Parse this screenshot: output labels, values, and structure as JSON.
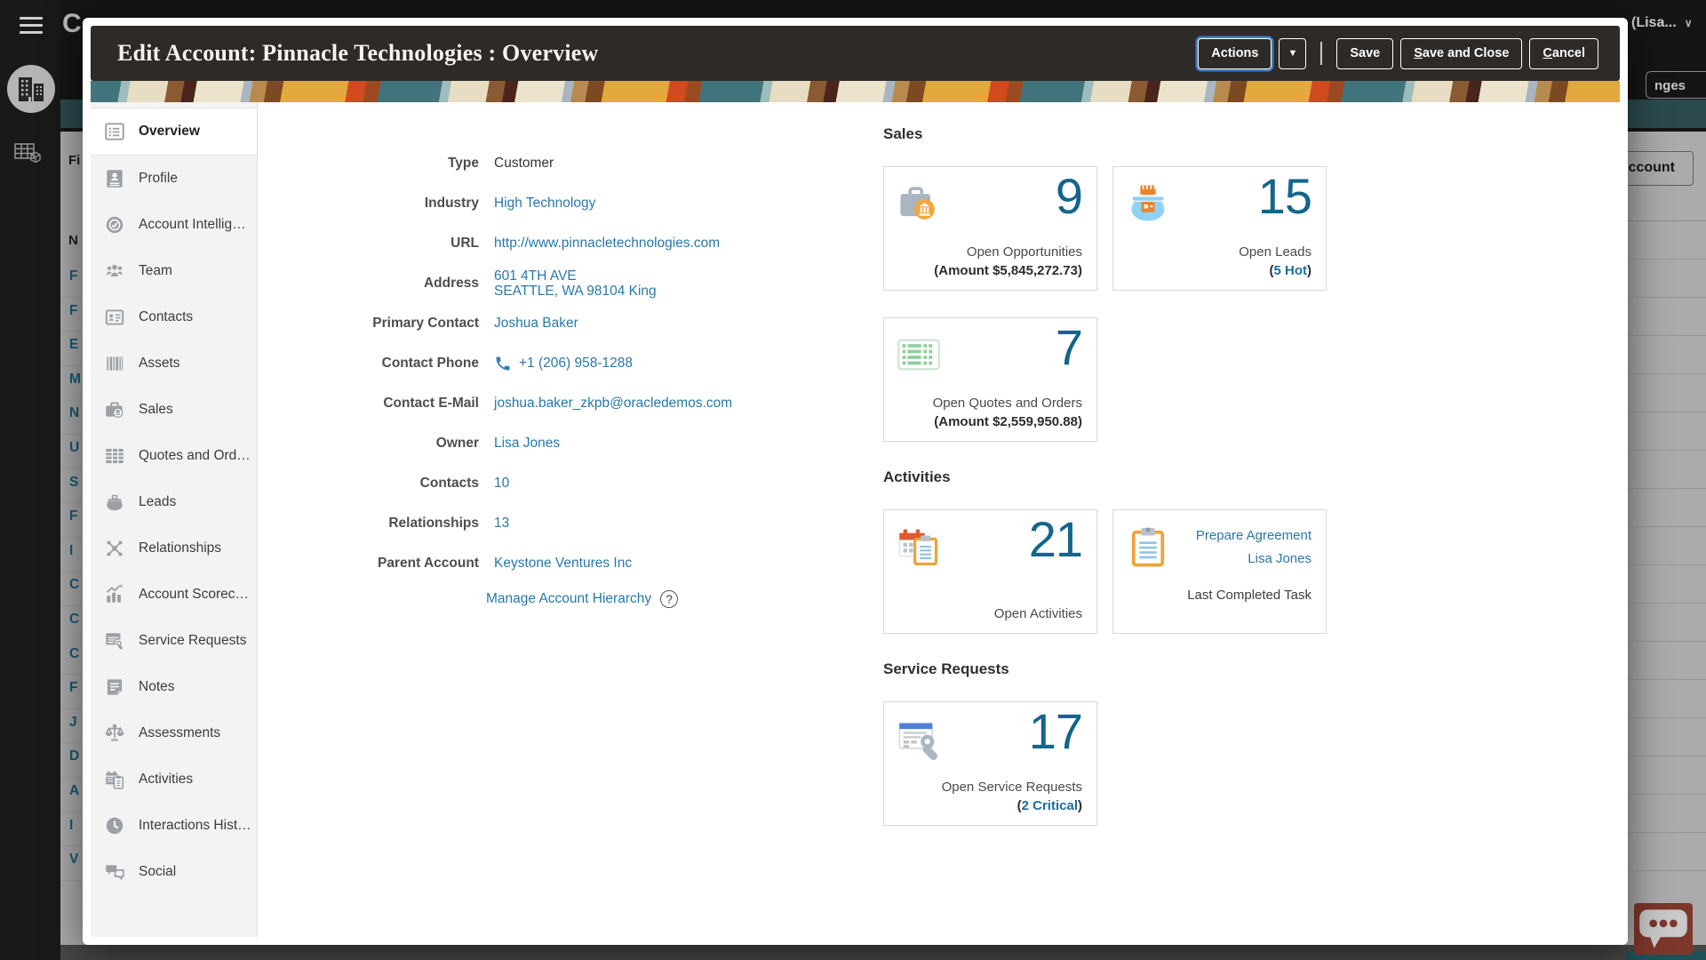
{
  "colors": {
    "accent_link": "#2878a8",
    "metric_number": "#13658b",
    "modal_header_bg": "#2e2a27",
    "sidebar_bg": "#f3f3f3",
    "card_border": "#d9d9d9",
    "bg_rail": "#191919",
    "bg_page": "#ababab",
    "bg_topbar": "#161513",
    "chat_orange": "#7d372b",
    "focus_ring": "#3d7fc2"
  },
  "background": {
    "user_menu_label": "(Lisa...",
    "user_menu_chevron": "∨",
    "changes_button_label": "nges",
    "account_button_label": "Account",
    "page_text_fragment": "Fi",
    "table_header_letter": "N",
    "row_letters": [
      "F",
      "F",
      "E",
      "M",
      "N",
      "U",
      "S",
      "F",
      "I",
      "C",
      "C",
      "C",
      "F",
      "J",
      "D",
      "A",
      "I",
      "V"
    ]
  },
  "modal": {
    "title": "Edit Account: Pinnacle Technologies : Overview",
    "toolbar": {
      "actions_label": "Actions",
      "actions_menu_icon": "▼",
      "save_label": "Save",
      "save_and_close_label": "Save and Close",
      "cancel_label": "Cancel"
    },
    "sidebar": {
      "items": [
        {
          "label": "Overview",
          "icon": "overview-icon",
          "selected": true
        },
        {
          "label": "Profile",
          "icon": "profile-icon"
        },
        {
          "label": "Account Intellig…",
          "icon": "account-intelligence-icon"
        },
        {
          "label": "Team",
          "icon": "team-icon"
        },
        {
          "label": "Contacts",
          "icon": "contacts-icon"
        },
        {
          "label": "Assets",
          "icon": "assets-icon"
        },
        {
          "label": "Sales",
          "icon": "sales-icon"
        },
        {
          "label": "Quotes and Ord…",
          "icon": "quotes-icon"
        },
        {
          "label": "Leads",
          "icon": "leads-icon"
        },
        {
          "label": "Relationships",
          "icon": "relationships-icon"
        },
        {
          "label": "Account Scorec…",
          "icon": "scorecard-icon"
        },
        {
          "label": "Service Requests",
          "icon": "service-requests-icon"
        },
        {
          "label": "Notes",
          "icon": "notes-icon"
        },
        {
          "label": "Assessments",
          "icon": "assessments-icon"
        },
        {
          "label": "Activities",
          "icon": "activities-icon"
        },
        {
          "label": "Interactions Hist…",
          "icon": "interactions-history-icon"
        },
        {
          "label": "Social",
          "icon": "social-icon"
        }
      ]
    },
    "fields": [
      {
        "label": "Type",
        "value": "Customer",
        "link": false
      },
      {
        "label": "Industry",
        "value": "High Technology",
        "link": true
      },
      {
        "label": "URL",
        "value": "http://www.pinnacletechnologies.com",
        "link": true
      },
      {
        "label": "Address",
        "value": "601 4TH AVE\nSEATTLE, WA 98104 King",
        "link": true
      },
      {
        "label": "Primary Contact",
        "value": "Joshua Baker",
        "link": true
      },
      {
        "label": "Contact Phone",
        "value": "+1 (206) 958-1288",
        "link": true,
        "icon": "phone-icon"
      },
      {
        "label": "Contact E-Mail",
        "value": "joshua.baker_zkpb@oracledemos.com",
        "link": true
      },
      {
        "label": "Owner",
        "value": "Lisa Jones",
        "link": true
      },
      {
        "label": "Contacts",
        "value": "10",
        "link": true
      },
      {
        "label": "Relationships",
        "value": "13",
        "link": true
      },
      {
        "label": "Parent Account",
        "value": "Keystone Ventures Inc",
        "link": true
      }
    ],
    "hierarchy_link_label": "Manage Account Hierarchy",
    "help_glyph": "?",
    "sections": [
      {
        "title": "Sales",
        "cards": [
          {
            "name": "open-opportunities",
            "icon": "opportunities-icon",
            "number": "9",
            "label": "Open Opportunities",
            "sub_open": "(",
            "sub_dark": "Amount $5,845,272.73",
            "sub_accent": "",
            "sub_close": ")"
          },
          {
            "name": "open-leads",
            "icon": "leads-big-icon",
            "number": "15",
            "label": "Open Leads",
            "sub_open": "(",
            "sub_dark": "",
            "sub_accent": "5 Hot",
            "sub_close": ")"
          },
          {
            "name": "open-quotes-and-orders",
            "icon": "quotes-big-icon",
            "number": "7",
            "label": "Open Quotes and Orders",
            "sub_open": "(",
            "sub_dark": "Amount $2,559,950.88",
            "sub_accent": "",
            "sub_close": ")"
          }
        ]
      },
      {
        "title": "Activities",
        "cards": [
          {
            "name": "open-activities",
            "icon": "activities-big-icon",
            "number": "21",
            "label": "Open Activities",
            "sub_open": "",
            "sub_dark": "",
            "sub_accent": "",
            "sub_close": ""
          },
          {
            "name": "last-completed-task",
            "icon": "task-clipboard-icon",
            "type": "task",
            "links": [
              "Prepare Agreement",
              "Lisa Jones"
            ],
            "label": "Last Completed Task"
          }
        ]
      },
      {
        "title": "Service Requests",
        "cards": [
          {
            "name": "open-service-requests",
            "icon": "service-requests-big-icon",
            "number": "17",
            "label": "Open Service Requests",
            "sub_open": "(",
            "sub_dark": "",
            "sub_accent": "2 Critical",
            "sub_close": ")"
          }
        ]
      }
    ]
  }
}
